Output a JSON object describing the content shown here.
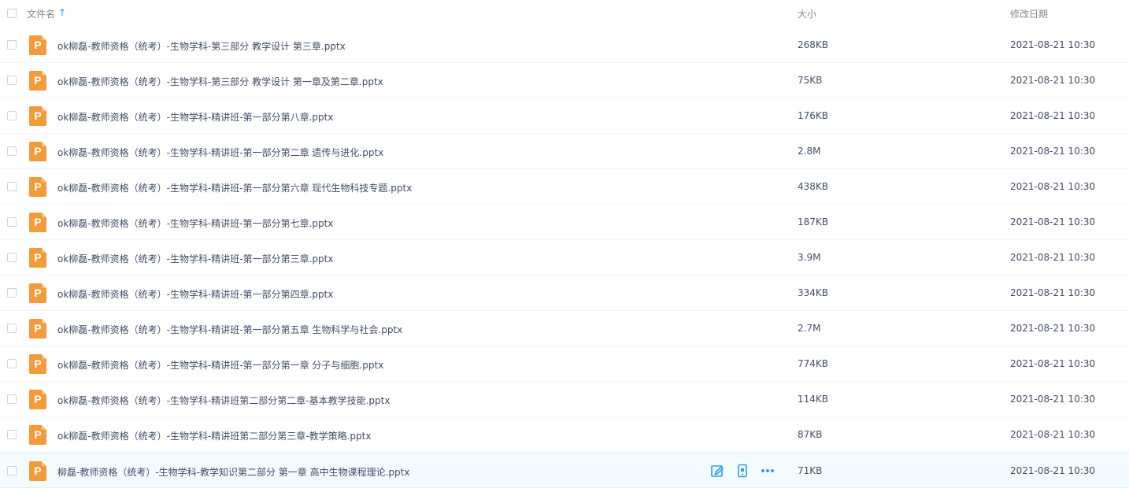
{
  "header": {
    "name_label": "文件名",
    "sort_arrow": "↑",
    "size_label": "大小",
    "date_label": "修改日期"
  },
  "file_icon_letter": "P",
  "accent_color": "#2e9bf0",
  "icon_color": "#f39b3b",
  "files": [
    {
      "name": "ok柳磊-教师资格（统考）-生物学科-第三部分 教学设计 第三章.pptx",
      "size": "268KB",
      "date": "2021-08-21 10:30"
    },
    {
      "name": "ok柳磊-教师资格（统考）-生物学科-第三部分 教学设计 第一章及第二章.pptx",
      "size": "75KB",
      "date": "2021-08-21 10:30"
    },
    {
      "name": "ok柳磊-教师资格（统考）-生物学科-精讲班-第一部分第八章.pptx",
      "size": "176KB",
      "date": "2021-08-21 10:30"
    },
    {
      "name": "ok柳磊-教师资格（统考）-生物学科-精讲班-第一部分第二章 遗传与进化.pptx",
      "size": "2.8M",
      "date": "2021-08-21 10:30"
    },
    {
      "name": "ok柳磊-教师资格（统考）-生物学科-精讲班-第一部分第六章 现代生物科技专题.pptx",
      "size": "438KB",
      "date": "2021-08-21 10:30"
    },
    {
      "name": "ok柳磊-教师资格（统考）-生物学科-精讲班-第一部分第七章.pptx",
      "size": "187KB",
      "date": "2021-08-21 10:30"
    },
    {
      "name": "ok柳磊-教师资格（统考）-生物学科-精讲班-第一部分第三章.pptx",
      "size": "3.9M",
      "date": "2021-08-21 10:30"
    },
    {
      "name": "ok柳磊-教师资格（统考）-生物学科-精讲班-第一部分第四章.pptx",
      "size": "334KB",
      "date": "2021-08-21 10:30"
    },
    {
      "name": "ok柳磊-教师资格（统考）-生物学科-精讲班-第一部分第五章 生物科学与社会.pptx",
      "size": "2.7M",
      "date": "2021-08-21 10:30"
    },
    {
      "name": "ok柳磊-教师资格（统考）-生物学科-精讲班-第一部分第一章 分子与细胞.pptx",
      "size": "774KB",
      "date": "2021-08-21 10:30"
    },
    {
      "name": "ok柳磊-教师资格（统考）-生物学科-精讲班第二部分第二章-基本教学技能.pptx",
      "size": "114KB",
      "date": "2021-08-21 10:30"
    },
    {
      "name": "ok柳磊-教师资格（统考）-生物学科-精讲班第二部分第三章-教学策略.pptx",
      "size": "87KB",
      "date": "2021-08-21 10:30"
    },
    {
      "name": "柳磊-教师资格（统考）-生物学科-教学知识第二部分 第一章 高中生物课程理论.pptx",
      "size": "71KB",
      "date": "2021-08-21 10:30",
      "hovered": true
    }
  ],
  "row_actions": [
    "edit-icon",
    "phone-icon",
    "more-icon"
  ]
}
